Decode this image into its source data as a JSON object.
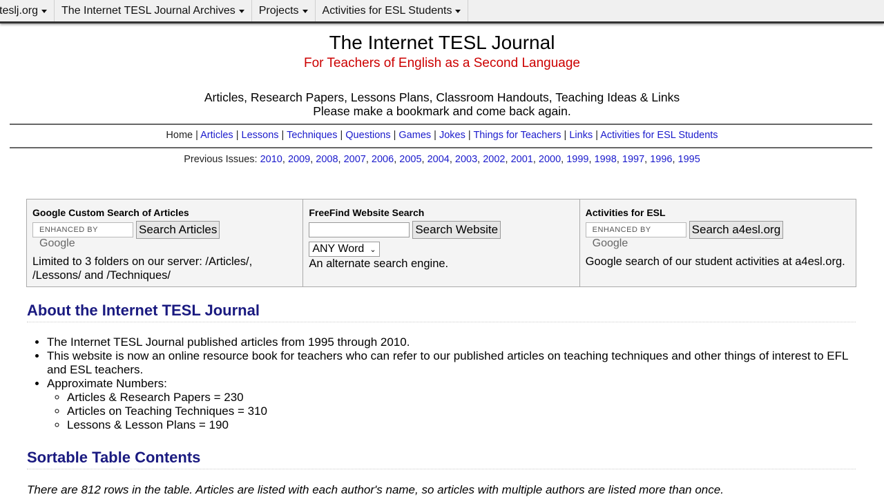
{
  "menubar": {
    "items": [
      {
        "label": "teslj.org"
      },
      {
        "label": "The Internet TESL Journal Archives"
      },
      {
        "label": "Projects"
      },
      {
        "label": "Activities for ESL Students"
      }
    ]
  },
  "header": {
    "title": "The Internet TESL Journal",
    "subtitle": "For Teachers of English as a Second Language",
    "tagline_1": "Articles, Research Papers, Lessons Plans, Classroom Handouts, Teaching Ideas & Links",
    "tagline_2": "Please make a bookmark and come back again."
  },
  "nav": {
    "home": "Home",
    "links": [
      "Articles",
      "Lessons",
      "Techniques",
      "Questions",
      "Games",
      "Jokes",
      "Things for Teachers",
      "Links",
      "Activities for ESL Students"
    ]
  },
  "issues": {
    "label": "Previous Issues:",
    "years": [
      "2010",
      "2009",
      "2008",
      "2007",
      "2006",
      "2005",
      "2004",
      "2003",
      "2002",
      "2001",
      "2000",
      "1999",
      "1998",
      "1997",
      "1996",
      "1995"
    ]
  },
  "search": {
    "google": {
      "heading": "Google Custom Search of Articles",
      "placeholder_small": "ENHANCED BY",
      "placeholder_brand": "Google",
      "button": "Search Articles",
      "note": "Limited to 3 folders on our server: /Articles/, /Lessons/ and /Techniques/"
    },
    "freefind": {
      "heading": "FreeFind Website Search",
      "button": "Search Website",
      "select_value": "ANY Word",
      "note": "An alternate search engine."
    },
    "a4esl": {
      "heading": "Activities for ESL",
      "placeholder_small": "ENHANCED BY",
      "placeholder_brand": "Google",
      "button": "Search a4esl.org",
      "note": "Google search of our student activities at a4esl.org."
    }
  },
  "about": {
    "heading": "About the Internet TESL Journal",
    "items": [
      "The Internet TESL Journal published articles from 1995 through 2010.",
      "This website is now an online resource book for teachers who can refer to our published articles on teaching techniques and other things of interest to EFL and ESL teachers.",
      "Approximate Numbers:"
    ],
    "numbers": [
      "Articles & Research Papers = 230",
      "Articles on Teaching Techniques = 310",
      "Lessons & Lesson Plans = 190"
    ]
  },
  "table_section": {
    "heading": "Sortable Table Contents",
    "note": "There are 812 rows in the table. Articles are listed with each author's name, so articles with multiple authors are listed more than once."
  }
}
